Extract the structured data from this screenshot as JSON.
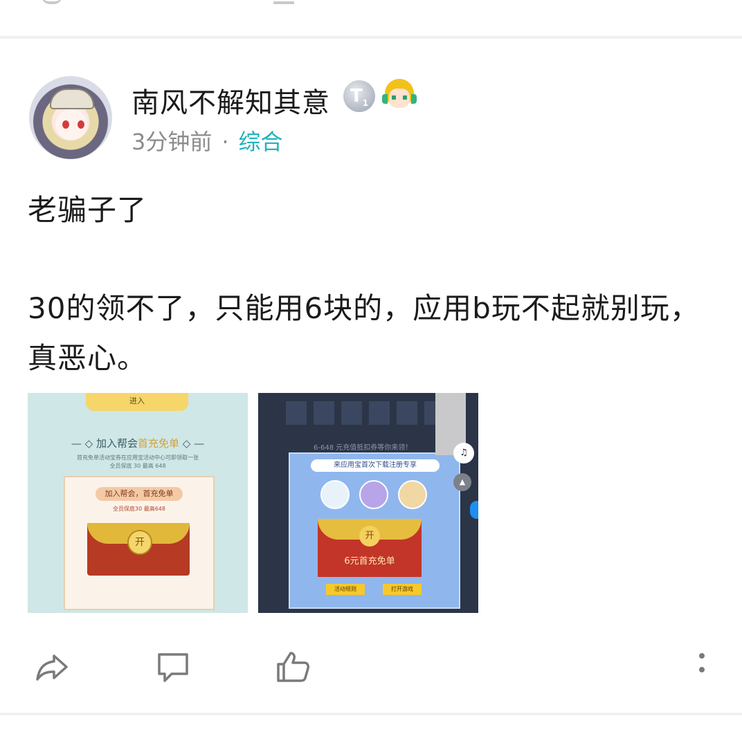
{
  "post": {
    "username": "南风不解知其意",
    "badge_letter": "T",
    "badge_sub": "1",
    "time": "3分钟前",
    "separator": "·",
    "category": "综合",
    "paragraph1": "老骗子了",
    "paragraph2": "30的领不了，只能用6块的，应用b玩不起就别玩，真恶心。"
  },
  "image1": {
    "enter": "进入",
    "title_prefix": "加入帮会",
    "title_highlight": "首充免单",
    "desc": "首充免单活动宝券在应用宝活动中心可即领取一张",
    "desc2": "全员保底 30 最高 648",
    "ribbon": "加入帮会，首充免单",
    "sub": "全员保底30 最高648",
    "coin": "开"
  },
  "image2": {
    "text": "6-648 元充值抵扣券等你来领！",
    "head": "来应用宝首次下载注册专享",
    "coin": "开",
    "label": "6元首充免单",
    "btn1": "活动规则",
    "btn2": "打开游戏",
    "fab_icon": "♫",
    "fab2_icon": "▲"
  },
  "actions": {
    "share_icon": "share-icon",
    "comment_icon": "comment-icon",
    "like_icon": "thumbs-up-icon",
    "more_icon": "more-vertical-icon"
  },
  "colors": {
    "category": "#23b2bd",
    "meta": "#8c8c8c",
    "divider": "#f1f1f3"
  }
}
